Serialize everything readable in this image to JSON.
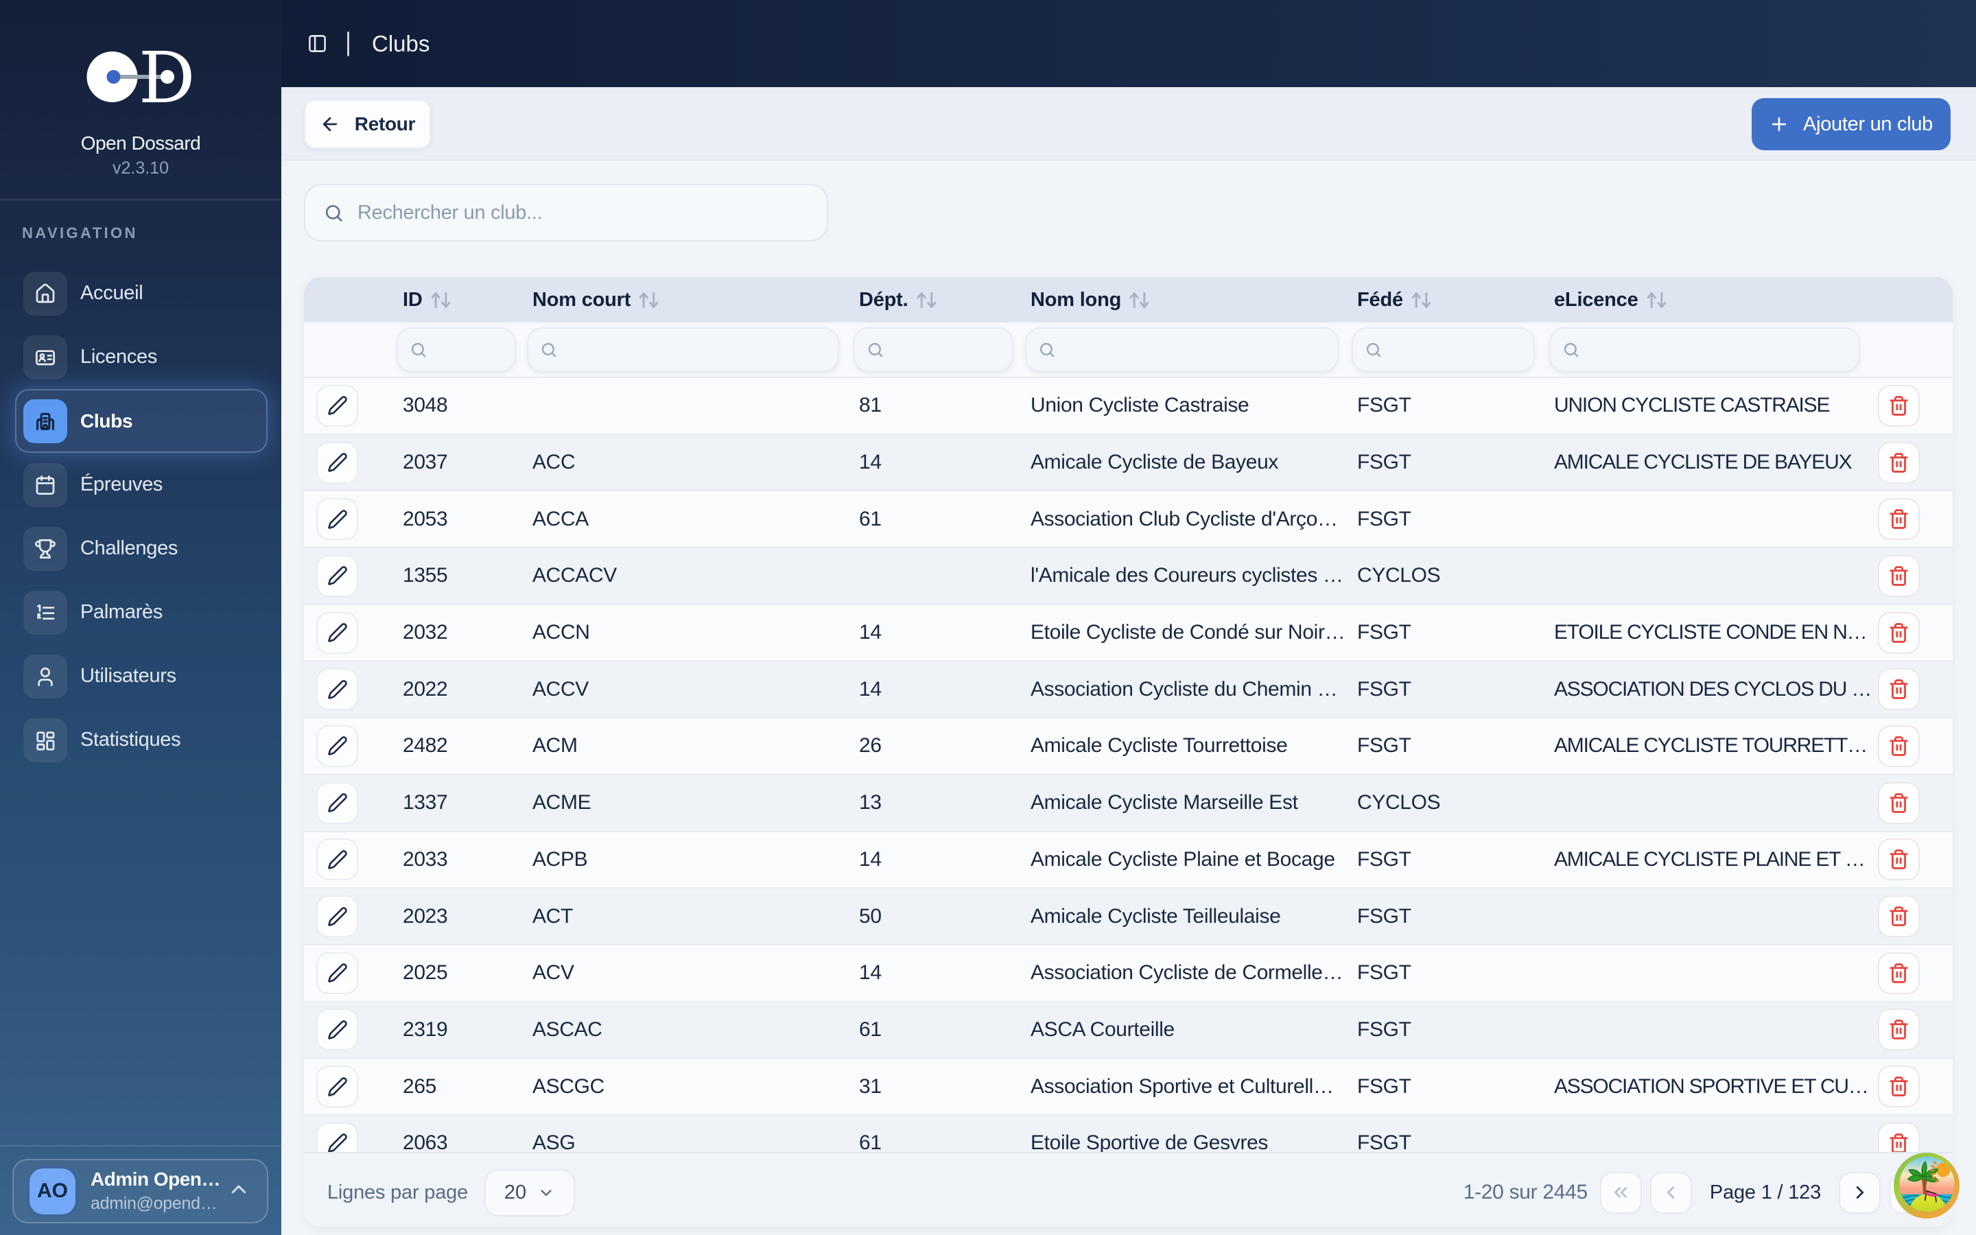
{
  "sidebar": {
    "logo_title": "Open Dossard",
    "version": "v2.3.10",
    "nav_label": "NAVIGATION",
    "items": [
      {
        "label": "Accueil",
        "icon": "home-icon",
        "active": false
      },
      {
        "label": "Licences",
        "icon": "id-card-icon",
        "active": false
      },
      {
        "label": "Clubs",
        "icon": "building-icon",
        "active": true
      },
      {
        "label": "Épreuves",
        "icon": "calendar-icon",
        "active": false
      },
      {
        "label": "Challenges",
        "icon": "trophy-icon",
        "active": false
      },
      {
        "label": "Palmarès",
        "icon": "list-ordered-icon",
        "active": false
      },
      {
        "label": "Utilisateurs",
        "icon": "user-icon",
        "active": false
      },
      {
        "label": "Statistiques",
        "icon": "dashboard-icon",
        "active": false
      }
    ],
    "user": {
      "initials": "AO",
      "name": "Admin Open…",
      "email": "admin@opend…"
    }
  },
  "topbar": {
    "title": "Clubs"
  },
  "page": {
    "back_label": "Retour",
    "add_label": "Ajouter un club",
    "search_placeholder": "Rechercher un club..."
  },
  "table": {
    "columns": [
      {
        "key": "id",
        "label": "ID"
      },
      {
        "key": "nom_court",
        "label": "Nom court"
      },
      {
        "key": "dept",
        "label": "Dépt."
      },
      {
        "key": "nom_long",
        "label": "Nom long"
      },
      {
        "key": "fede",
        "label": "Fédé"
      },
      {
        "key": "elicence",
        "label": "eLicence"
      }
    ],
    "rows": [
      {
        "id": "3048",
        "nom_court": "",
        "dept": "81",
        "nom_long": "Union Cycliste Castraise",
        "fede": "FSGT",
        "elicence": "UNION CYCLISTE CASTRAISE"
      },
      {
        "id": "2037",
        "nom_court": "ACC",
        "dept": "14",
        "nom_long": "Amicale Cycliste de Bayeux",
        "fede": "FSGT",
        "elicence": "AMICALE CYCLISTE DE BAYEUX"
      },
      {
        "id": "2053",
        "nom_court": "ACCA",
        "dept": "61",
        "nom_long": "Association Club Cycliste d'Arço…",
        "fede": "FSGT",
        "elicence": ""
      },
      {
        "id": "1355",
        "nom_court": "ACCACV",
        "dept": "",
        "nom_long": "l'Amicale des Coureurs cyclistes …",
        "fede": "CYCLOS",
        "elicence": ""
      },
      {
        "id": "2032",
        "nom_court": "ACCN",
        "dept": "14",
        "nom_long": "Etoile Cycliste de Condé sur Noir…",
        "fede": "FSGT",
        "elicence": "ETOILE CYCLISTE CONDE EN N…"
      },
      {
        "id": "2022",
        "nom_court": "ACCV",
        "dept": "14",
        "nom_long": "Association Cycliste du Chemin …",
        "fede": "FSGT",
        "elicence": "ASSOCIATION DES CYCLOS DU …"
      },
      {
        "id": "2482",
        "nom_court": "ACM",
        "dept": "26",
        "nom_long": "Amicale Cycliste Tourrettoise",
        "fede": "FSGT",
        "elicence": "AMICALE CYCLISTE TOURRETT…"
      },
      {
        "id": "1337",
        "nom_court": "ACME",
        "dept": "13",
        "nom_long": "Amicale Cycliste Marseille Est",
        "fede": "CYCLOS",
        "elicence": ""
      },
      {
        "id": "2033",
        "nom_court": "ACPB",
        "dept": "14",
        "nom_long": "Amicale Cycliste Plaine et Bocage",
        "fede": "FSGT",
        "elicence": "AMICALE CYCLISTE PLAINE ET …"
      },
      {
        "id": "2023",
        "nom_court": "ACT",
        "dept": "50",
        "nom_long": "Amicale Cycliste Teilleulaise",
        "fede": "FSGT",
        "elicence": ""
      },
      {
        "id": "2025",
        "nom_court": "ACV",
        "dept": "14",
        "nom_long": "Association Cycliste de Cormelle…",
        "fede": "FSGT",
        "elicence": ""
      },
      {
        "id": "2319",
        "nom_court": "ASCAC",
        "dept": "61",
        "nom_long": "ASCA Courteille",
        "fede": "FSGT",
        "elicence": ""
      },
      {
        "id": "265",
        "nom_court": "ASCGC",
        "dept": "31",
        "nom_long": "Association Sportive et Culturell…",
        "fede": "FSGT",
        "elicence": "ASSOCIATION SPORTIVE ET CU…"
      },
      {
        "id": "2063",
        "nom_court": "ASG",
        "dept": "61",
        "nom_long": "Etoile Sportive de Gesvres",
        "fede": "FSGT",
        "elicence": ""
      }
    ]
  },
  "footer": {
    "rows_per_page_label": "Lignes par page",
    "rows_per_page": "20",
    "range": "1-20 sur 2445",
    "page_label": "Page 1 / 123"
  },
  "colors": {
    "accent_blue": "#3e70c8",
    "active_chip_blue": "#5b9af3",
    "danger_red": "#e8463f"
  }
}
